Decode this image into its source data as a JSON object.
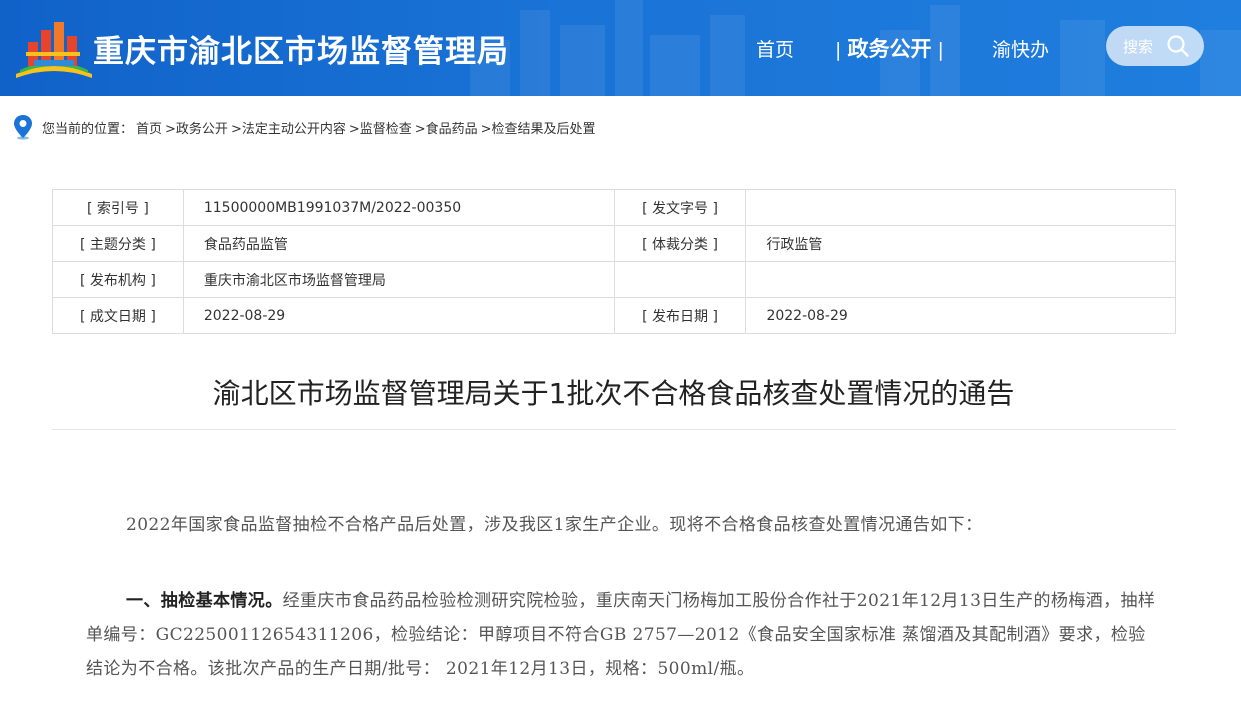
{
  "header": {
    "site_title": "重庆市渝北区市场监督管理局",
    "nav": [
      {
        "label": "首页"
      },
      {
        "label": "政务公开"
      },
      {
        "label": "渝快办"
      }
    ],
    "search_label": "搜索",
    "colors": {
      "header_bg": "#1a73d6",
      "text": "#ffffff"
    }
  },
  "breadcrumb": {
    "prefix": "您当前的位置：",
    "items": [
      "首页",
      ">政务公开",
      ">法定主动公开内容",
      ">监督检查",
      ">食品药品",
      ">检查结果及后处置"
    ]
  },
  "meta": {
    "rows": [
      {
        "k1": "[ 索引号 ]",
        "v1": "11500000MB1991037M/2022-00350",
        "k2": "[ 发文字号 ]",
        "v2": ""
      },
      {
        "k1": "[ 主题分类 ]",
        "v1": "食品药品监管",
        "k2": "[ 体裁分类 ]",
        "v2": "行政监管"
      },
      {
        "k1": "[ 发布机构 ]",
        "v1": "重庆市渝北区市场监督管理局",
        "k2": "",
        "v2": ""
      },
      {
        "k1": "[ 成文日期 ]",
        "v1": "2022-08-29",
        "k2": "[ 发布日期 ]",
        "v2": "2022-08-29"
      }
    ]
  },
  "article": {
    "title": "渝北区市场监督管理局关于1批次不合格食品核查处置情况的通告",
    "p1": "2022年国家食品监督抽检不合格产品后处置，涉及我区1家生产企业。现将不合格食品核查处置情况通告如下：",
    "p2_heading": "一、抽检基本情况。",
    "p2_body": "经重庆市食品药品检验检测研究院检验，重庆南天门杨梅加工股份合作社于2021年12月13日生产的杨梅酒，抽样单编号：GC22500112654311206，检验结论：甲醇项目不符合GB 2757—2012《食品安全国家标准 蒸馏酒及其配制酒》要求，检验结论为不合格。该批次产品的生产日期/批号： 2021年12月13日，规格：500ml/瓶。"
  }
}
